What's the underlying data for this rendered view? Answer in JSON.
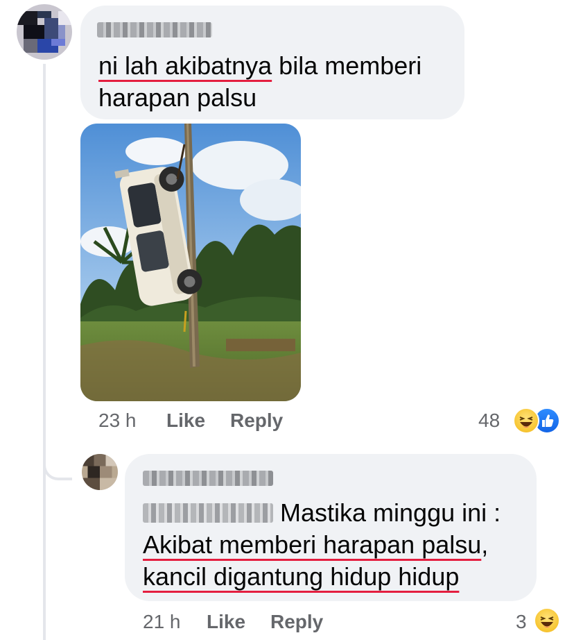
{
  "comment1": {
    "author": "",
    "text_underlined": "ni lah akibatnya",
    "text_rest": " bila memberi",
    "text_line2": "harapan palsu",
    "time": "23 h",
    "like_label": "Like",
    "reply_label": "Reply",
    "reaction_count": "48",
    "reactions": [
      "haha-icon",
      "like-icon"
    ]
  },
  "reply1": {
    "author": "",
    "mention": "",
    "text_line1": " Mastika minggu ini :",
    "text_line2": "Akibat memberi harapan palsu",
    "text_line2_suffix": ",",
    "text_line3": "kancil digantung hidup hidup",
    "time": "21 h",
    "like_label": "Like",
    "reply_label": "Reply",
    "reaction_count": "3",
    "reactions": [
      "haha-icon"
    ]
  },
  "colors": {
    "bubble": "#f0f2f5",
    "meta": "#65676b",
    "underline": "#e41e3f",
    "like_blue": "#1877f2"
  }
}
